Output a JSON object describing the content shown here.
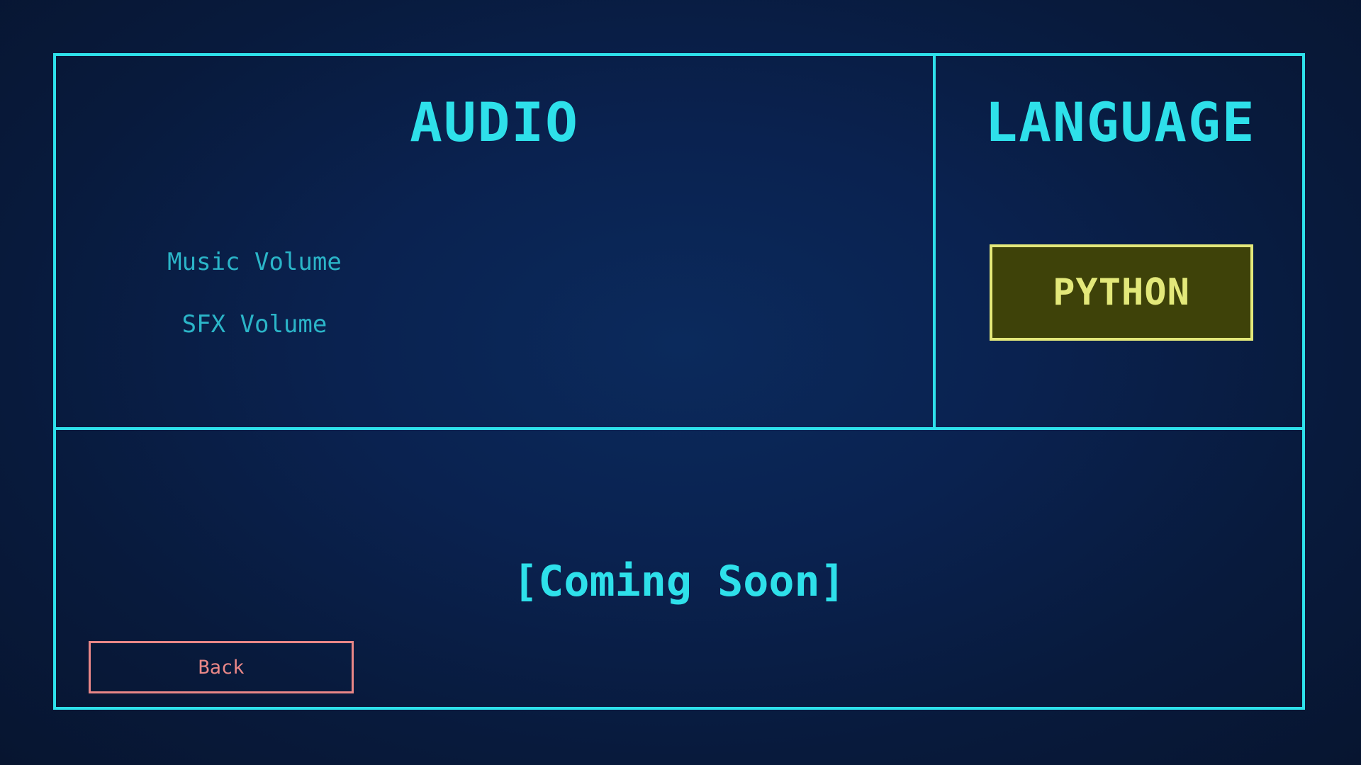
{
  "audio": {
    "title": "AUDIO",
    "music_volume_label": "Music Volume",
    "sfx_volume_label": "SFX Volume"
  },
  "language": {
    "title": "LANGUAGE",
    "selected_option": "PYTHON"
  },
  "bottom_panel": {
    "placeholder_text": "[Coming Soon]",
    "back_label": "Back"
  },
  "colors": {
    "accent": "#2ee0ea",
    "label": "#2bb5c8",
    "language_button_border": "#e3e87a",
    "language_button_fill": "#3e4209",
    "back_button": "#e98787",
    "background": "#0a2250"
  }
}
